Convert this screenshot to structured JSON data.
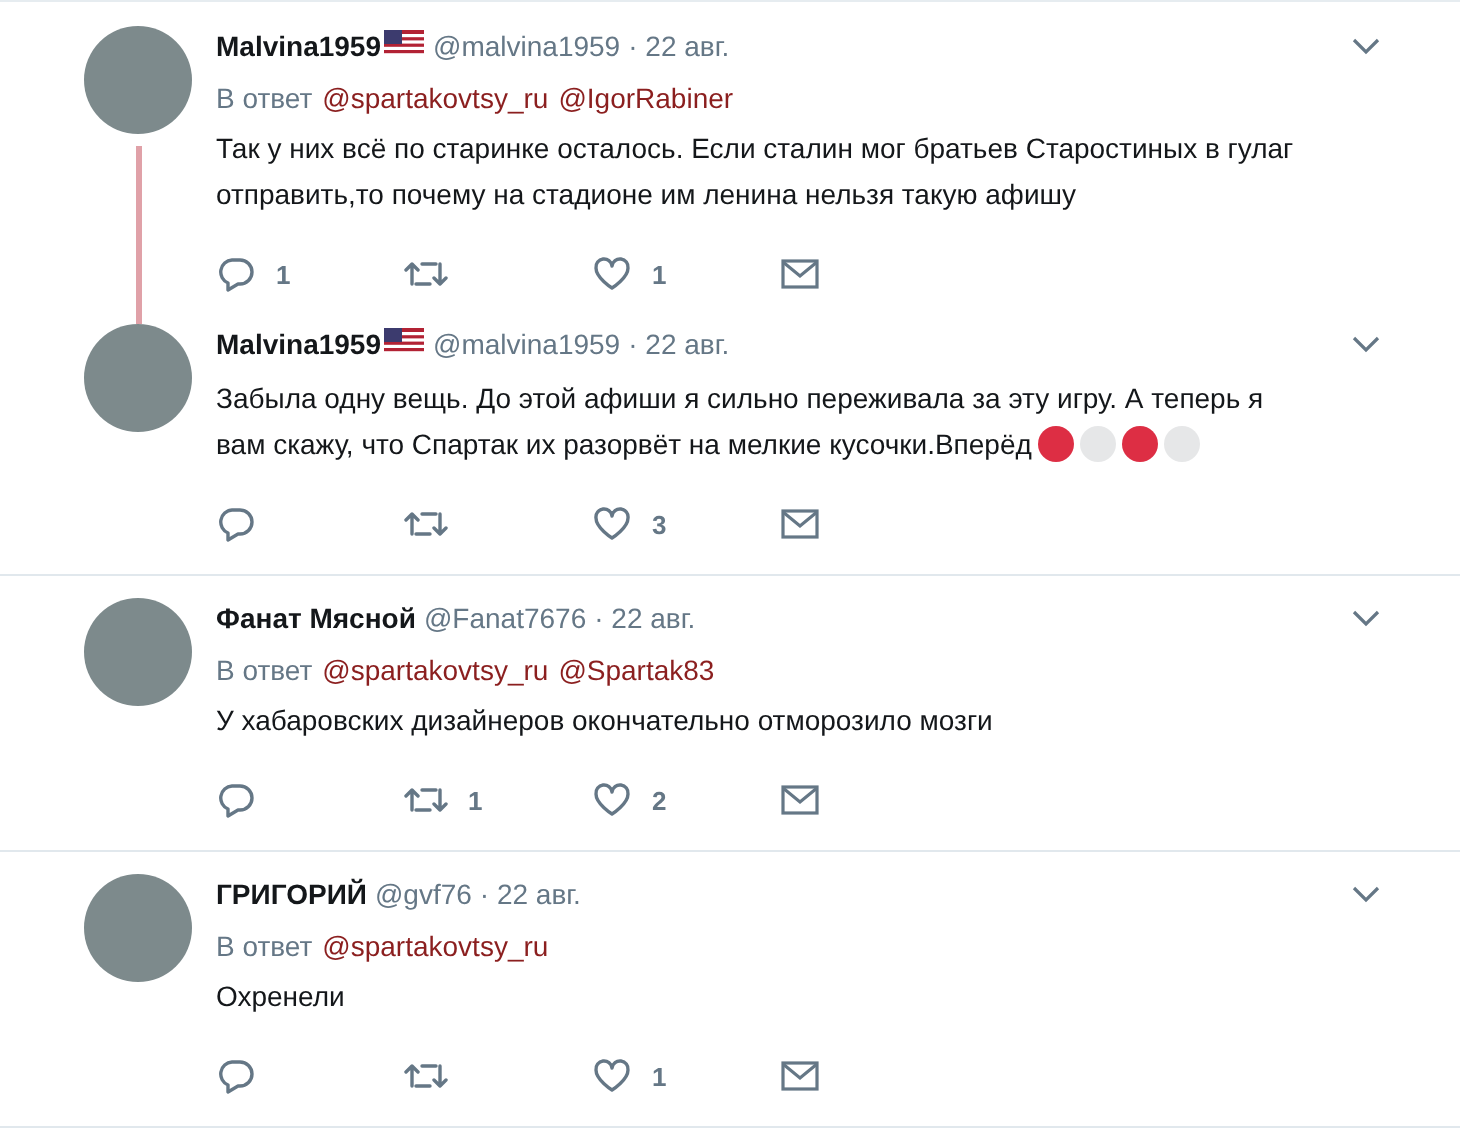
{
  "conversations": [
    {
      "tweets": [
        {
          "name": "Malvina1959",
          "flag": true,
          "handle": "@malvina1959",
          "date": "· 22 авг.",
          "reply_label": "В ответ",
          "reply_to": [
            "@spartakovtsy_ru",
            "@IgorRabiner"
          ],
          "text": "Так у них всё по старинке осталось. Если сталин мог братьев Старостиных в гулаг отправить,то почему на стадионе им ленина нельзя такую афишу",
          "replies": "1",
          "likes": "1"
        },
        {
          "name": "Malvina1959",
          "flag": true,
          "handle": "@malvina1959",
          "date": "· 22 авг.",
          "text": "Забыла одну вещь. До этой афиши я сильно переживала за эту игру. А теперь я вам скажу, что Спартак их разорвёт на мелкие кусочки.Вперёд",
          "emoji": [
            {
              "color": "#dd2e44"
            },
            {
              "color": "#e6e7e8"
            },
            {
              "color": "#dd2e44"
            },
            {
              "color": "#e6e7e8"
            }
          ],
          "likes": "3"
        }
      ]
    },
    {
      "tweets": [
        {
          "name": "Фанат Мясной",
          "handle": "@Fanat7676",
          "date": "· 22 авг.",
          "reply_label": "В ответ",
          "reply_to": [
            "@spartakovtsy_ru",
            "@Spartak83"
          ],
          "text": "У хабаровских дизайнеров окончательно отморозило мозги",
          "retweets": "1",
          "likes": "2"
        }
      ]
    },
    {
      "tweets": [
        {
          "name": "ГРИГОРИЙ",
          "handle": "@gvf76",
          "date": "· 22 авг.",
          "reply_label": "В ответ",
          "reply_to": [
            "@spartakovtsy_ru"
          ],
          "text": "Охренели",
          "likes": "1"
        }
      ]
    }
  ]
}
